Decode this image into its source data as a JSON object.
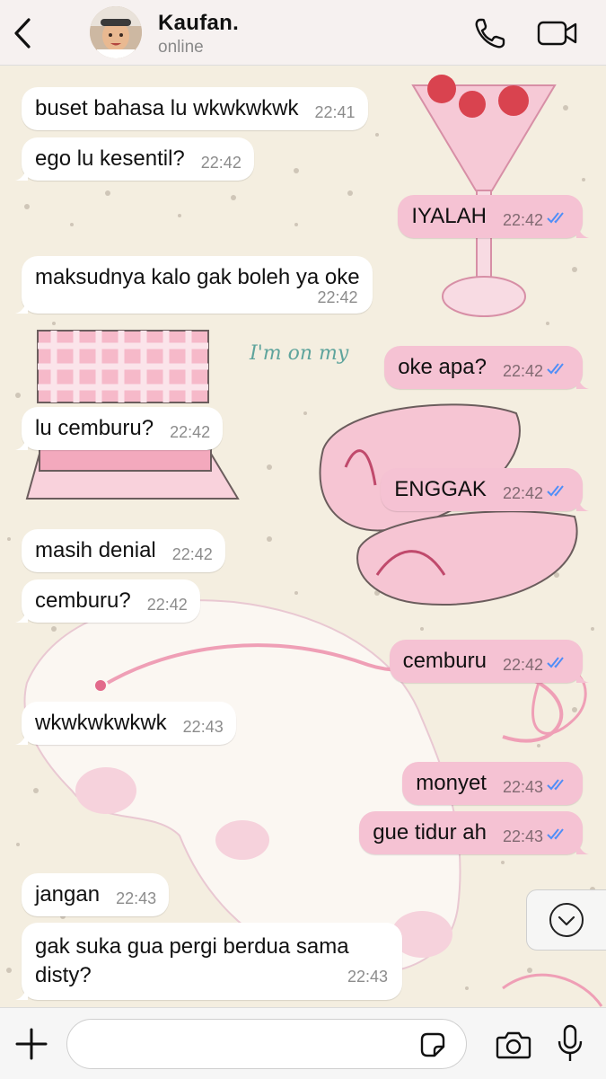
{
  "header": {
    "contact_name": "Kaufan.",
    "contact_status": "online"
  },
  "colors": {
    "outgoing_bubble": "#f5c2d3",
    "incoming_bubble": "#ffffff",
    "read_ticks": "#4f8ef7",
    "wallpaper": "#f4eee0"
  },
  "wallpaper_text": {
    "line1": "I'm on my"
  },
  "messages": [
    {
      "dir": "in",
      "text": "buset bahasa lu wkwkwkwk",
      "time": "22:41"
    },
    {
      "dir": "in",
      "text": "ego lu kesentil?",
      "time": "22:42"
    },
    {
      "dir": "out",
      "text": "IYALAH",
      "time": "22:42",
      "read": true
    },
    {
      "dir": "in",
      "text": "maksudnya kalo gak boleh ya oke",
      "time": "22:42"
    },
    {
      "dir": "out",
      "text": "oke apa?",
      "time": "22:42",
      "read": true
    },
    {
      "dir": "in",
      "text": "lu cemburu?",
      "time": "22:42"
    },
    {
      "dir": "out",
      "text": "ENGGAK",
      "time": "22:42",
      "read": true
    },
    {
      "dir": "in",
      "text": "masih denial",
      "time": "22:42"
    },
    {
      "dir": "in",
      "text": "cemburu?",
      "time": "22:42"
    },
    {
      "dir": "out",
      "text": "cemburu",
      "time": "22:42",
      "read": true
    },
    {
      "dir": "in",
      "text": "wkwkwkwkwk",
      "time": "22:43"
    },
    {
      "dir": "out",
      "text": "monyet",
      "time": "22:43",
      "read": true
    },
    {
      "dir": "out",
      "text": "gue tidur ah",
      "time": "22:43",
      "read": true
    },
    {
      "dir": "in",
      "text": "jangan",
      "time": "22:43"
    },
    {
      "dir": "in",
      "text": "gak suka gua pergi berdua sama disty?",
      "time": "22:43"
    }
  ],
  "input": {
    "placeholder": "",
    "value": ""
  },
  "icons": {
    "back": "chevron-left-icon",
    "call": "phone-icon",
    "video": "video-camera-icon",
    "scroll": "chevron-down-circle-icon",
    "attach": "plus-icon",
    "sticker": "sticker-icon",
    "camera": "camera-icon",
    "mic": "microphone-icon"
  }
}
